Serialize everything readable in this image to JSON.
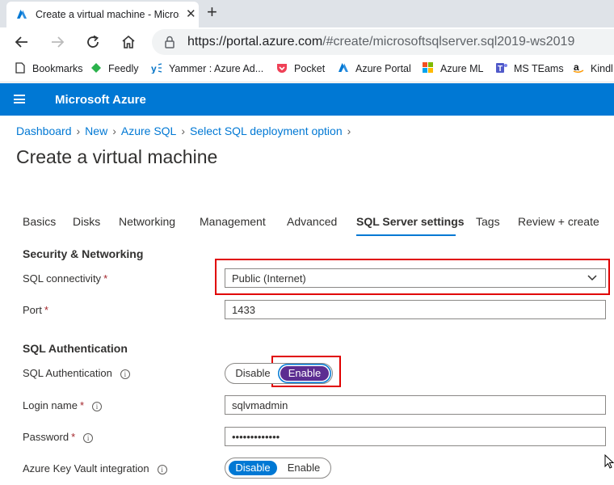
{
  "browser": {
    "tab_title": "Create a virtual machine - Micros",
    "url_main": "https://portal.azure.com",
    "url_rest": "/#create/microsoftsqlserver.sql2019-ws2019",
    "bookmarks": [
      "Bookmarks",
      "Feedly",
      "Yammer : Azure Ad...",
      "Pocket",
      "Azure Portal",
      "Azure ML",
      "MS TEams",
      "Kindl"
    ]
  },
  "azure": {
    "brand": "Microsoft Azure"
  },
  "breadcrumb": [
    "Dashboard",
    "New",
    "Azure SQL",
    "Select SQL deployment option"
  ],
  "page_title": "Create a virtual machine",
  "tabs": [
    "Basics",
    "Disks",
    "Networking",
    "Management",
    "Advanced",
    "SQL Server settings",
    "Tags",
    "Review + create"
  ],
  "active_tab": "SQL Server settings",
  "form": {
    "section_security": "Security & Networking",
    "sql_connectivity_label": "SQL connectivity",
    "sql_connectivity_value": "Public (Internet)",
    "port_label": "Port",
    "port_value": "1433",
    "section_auth": "SQL Authentication",
    "sql_auth_label": "SQL Authentication",
    "sql_auth_options": [
      "Disable",
      "Enable"
    ],
    "sql_auth_selected": "Enable",
    "login_label": "Login name",
    "login_value": "sqlvmadmin",
    "password_label": "Password",
    "password_value": "•••••••••••••",
    "akv_label": "Azure Key Vault integration",
    "akv_options": [
      "Disable",
      "Enable"
    ],
    "akv_selected": "Disable",
    "required_mark": "*"
  },
  "colors": {
    "azure_blue": "#0078d4",
    "highlight_red": "#e00000",
    "selected_purple": "#5c2d91"
  }
}
